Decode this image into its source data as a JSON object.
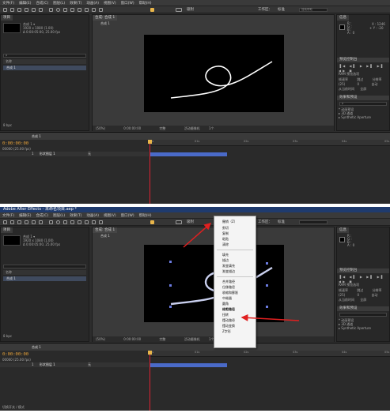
{
  "window": {
    "title": "Adobe After Effects - 未命名项目.aep *"
  },
  "menu": [
    "文件(F)",
    "编辑(E)",
    "合成(C)",
    "图层(L)",
    "效果(T)",
    "动画(A)",
    "视图(V)",
    "窗口(W)",
    "帮助(H)"
  ],
  "toolbar": {
    "snap_label": "吸附",
    "workspace_label": "工作区：",
    "workspace_value": "标准",
    "search_placeholder": "搜索帮助"
  },
  "project": {
    "tab": "项目",
    "comp_name": "合成 1 ▾",
    "comp_size": "1920 x 1080 (1.00)",
    "comp_duration": "Δ 0:00:05:00, 25.00 fps",
    "search_placeholder": "ρ",
    "col_name": "名称",
    "item_name": "合成 1",
    "bpc": "8 bpc"
  },
  "viewer": {
    "tab": "合成: 合成 1",
    "breadcrumb": "合成 1",
    "zoom": "(50%)",
    "timecode": "0:00:00:00",
    "quality": "完整",
    "camera": "活动摄像机",
    "views": "1个"
  },
  "right_panel": {
    "info_tab": "信息",
    "info_r": "R :",
    "info_g": "G :",
    "info_b": "B :",
    "info_a": "A : 0",
    "info_x": "X : 1246",
    "info_y": "+ Y : -20",
    "preview_tab": "预览控制台",
    "ram_label": "RAM 预览选项",
    "fps_label": "帧速率",
    "skip_label": "跳过",
    "res_label": "分辨率",
    "fps_value": "(25)",
    "skip_value": "0",
    "res_value": "自动",
    "from_label": "从当前时间",
    "full_label": "全屏",
    "effects_tab": "效果和预设",
    "effects_search": "ρ",
    "effects_items": [
      "* 动画预设",
      "▸ 3D 通道",
      "▸ Synthetic Aperture"
    ]
  },
  "timeline": {
    "timecode": "0:00:00:00",
    "frames": "00000 (25.00 fps)",
    "comp_tab": "合成 1",
    "layer_name": "形状图层 1",
    "layer_index": "1",
    "mode": "无",
    "toggle_label": "切换开关 / 模式",
    "ruler_ticks": [
      "0s",
      "01s",
      "02s",
      "03s",
      "04s",
      "05s"
    ]
  },
  "context_menu": {
    "items": [
      "撤销（Z）",
      "剪切",
      "复制",
      "粘贴",
      "清除",
      "---",
      "填充",
      "描边",
      "渐变填充",
      "渐变描边",
      "---",
      "合并路径",
      "位移路径",
      "收缩和膨胀",
      "中继器",
      "圆角",
      "修剪路径",
      "扭转",
      "摆动路径",
      "摆动变换",
      "Z字形"
    ],
    "highlighted": "修剪路径"
  },
  "colors": {
    "panel_bg": "#282828",
    "timecode": "#e8a33a",
    "layer_bar": "#4a6ac8",
    "playhead": "#dd2233",
    "arrow": "#e02020",
    "titlebar": "#1f3b6e"
  }
}
